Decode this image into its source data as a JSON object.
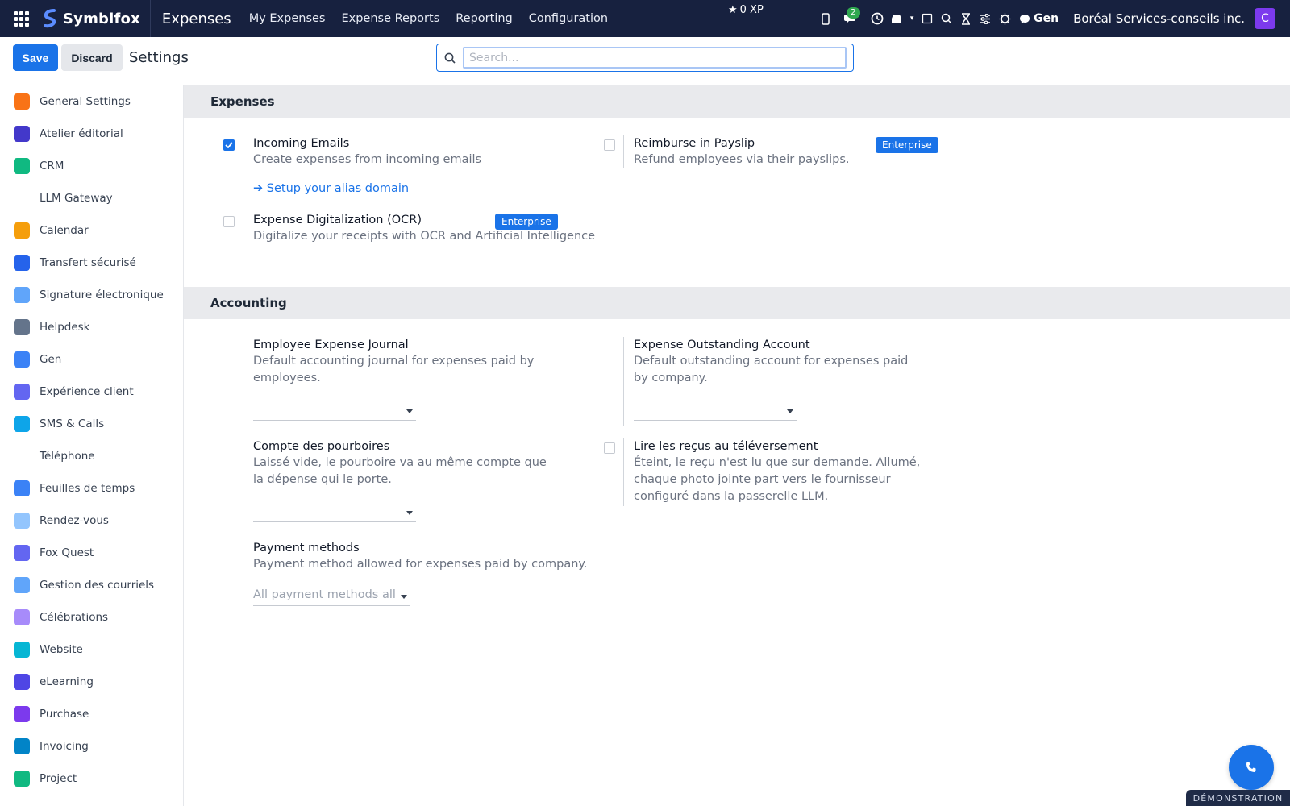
{
  "topbar": {
    "brand": "Symbifox",
    "app_title": "Expenses",
    "menu": [
      "My Expenses",
      "Expense Reports",
      "Reporting",
      "Configuration"
    ],
    "xp": "0 XP",
    "messages_count": "2",
    "gen_label": "Gen",
    "company": "Boréal Services-conseils inc.",
    "avatar_letter": "C"
  },
  "controls": {
    "save_label": "Save",
    "discard_label": "Discard",
    "page_title": "Settings",
    "search_placeholder": "Search..."
  },
  "sidebar": {
    "items": [
      {
        "label": "General Settings",
        "color": "#f97316"
      },
      {
        "label": "Atelier éditorial",
        "color": "#4338ca"
      },
      {
        "label": "CRM",
        "color": "#10b981"
      },
      {
        "label": "LLM Gateway",
        "color": ""
      },
      {
        "label": "Calendar",
        "color": "#f59e0b"
      },
      {
        "label": "Transfert sécurisé",
        "color": "#2563eb"
      },
      {
        "label": "Signature électronique",
        "color": "#60a5fa"
      },
      {
        "label": "Helpdesk",
        "color": "#64748b"
      },
      {
        "label": "Gen",
        "color": "#3b82f6"
      },
      {
        "label": "Expérience client",
        "color": "#6366f1"
      },
      {
        "label": "SMS & Calls",
        "color": "#0ea5e9"
      },
      {
        "label": "Téléphone",
        "color": ""
      },
      {
        "label": "Feuilles de temps",
        "color": "#3b82f6"
      },
      {
        "label": "Rendez-vous",
        "color": "#93c5fd"
      },
      {
        "label": "Fox Quest",
        "color": "#6366f1"
      },
      {
        "label": "Gestion des courriels",
        "color": "#60a5fa"
      },
      {
        "label": "Célébrations",
        "color": "#a78bfa"
      },
      {
        "label": "Website",
        "color": "#06b6d4"
      },
      {
        "label": "eLearning",
        "color": "#4f46e5"
      },
      {
        "label": "Purchase",
        "color": "#7c3aed"
      },
      {
        "label": "Invoicing",
        "color": "#0284c7"
      },
      {
        "label": "Project",
        "color": "#10b981"
      }
    ]
  },
  "expenses": {
    "heading": "Expenses",
    "incoming_emails": {
      "title": "Incoming Emails",
      "desc": "Create expenses from incoming emails",
      "link": "➔ Setup your alias domain",
      "checked": true
    },
    "ocr": {
      "title": "Expense Digitalization (OCR)",
      "desc": "Digitalize your receipts with OCR and Artificial Intelligence",
      "badge": "Enterprise",
      "checked": false
    },
    "payslip": {
      "title": "Reimburse in Payslip",
      "desc": "Refund employees via their payslips.",
      "badge": "Enterprise",
      "checked": false
    }
  },
  "accounting": {
    "heading": "Accounting",
    "journal": {
      "title": "Employee Expense Journal",
      "desc": "Default accounting journal for expenses paid by employees."
    },
    "outstanding": {
      "title": "Expense Outstanding Account",
      "desc": "Default outstanding account for expenses paid by company."
    },
    "tips": {
      "title": "Compte des pourboires",
      "desc": "Laissé vide, le pourboire va au même compte que la dépense qui le porte."
    },
    "receipts": {
      "title": "Lire les reçus au téléversement",
      "desc": "Éteint, le reçu n'est lu que sur demande. Allumé, chaque photo jointe part vers le fournisseur configuré dans la passerelle LLM.",
      "checked": false
    },
    "payment": {
      "title": "Payment methods",
      "desc": "Payment method allowed for expenses paid by company.",
      "placeholder": "All payment methods all..."
    }
  },
  "demo_tag": "DÉMONSTRATION"
}
